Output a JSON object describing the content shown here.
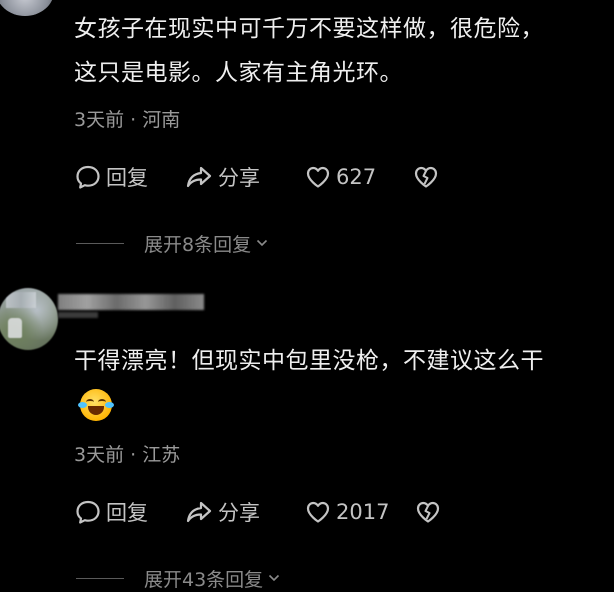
{
  "colors": {
    "background": "#000000",
    "text_primary": "#efefef",
    "text_meta": "#9a9a9a",
    "action_text": "#c4c4c4"
  },
  "comments": [
    {
      "text_lines": [
        "女孩子在现实中可千万不要这样做，很危险，",
        "这只是电影。人家有主角光环。"
      ],
      "meta": "3天前 · 河南",
      "actions": {
        "reply_label": "回复",
        "share_label": "分享",
        "like_count": "627"
      },
      "expand_label": "展开8条回复"
    },
    {
      "text_lines": [
        "干得漂亮！但现实中包里没枪，不建议这么干"
      ],
      "emoji": "rolling-on-floor-laughing",
      "meta": "3天前 · 江苏",
      "actions": {
        "reply_label": "回复",
        "share_label": "分享",
        "like_count": "2017"
      },
      "expand_label": "展开43条回复"
    }
  ],
  "icons": {
    "reply": "speech-bubble-icon",
    "share": "share-arrow-icon",
    "like": "heart-icon",
    "dislike": "broken-heart-icon",
    "expand": "chevron-down-icon"
  }
}
